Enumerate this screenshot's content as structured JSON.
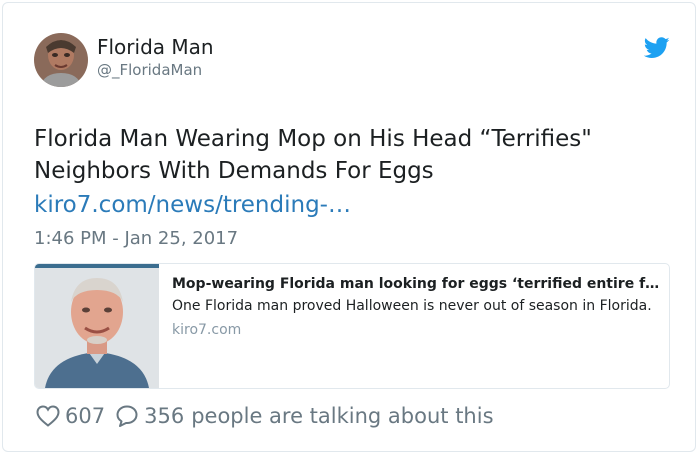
{
  "author": {
    "display_name": "Florida Man",
    "handle": "@_FloridaMan",
    "avatar_icon": "avatar-photo"
  },
  "tweet": {
    "text": "Florida Man Wearing Mop on His Head “Terrifies\" Neighbors With Demands For Eggs",
    "link_text": "kiro7.com/news/trending-…",
    "timestamp": "1:46 PM - Jan 25, 2017"
  },
  "link_card": {
    "title": "Mop-wearing Florida man looking for eggs ‘terrified entire f…",
    "description": "One Florida man proved Halloween is never out of season in Florida.",
    "domain": "kiro7.com",
    "image_icon": "mugshot-photo"
  },
  "actions": {
    "likes": "607",
    "replies": "356",
    "talking_text": "people are talking about this"
  },
  "colors": {
    "brand": "#1da1f2",
    "link": "#2b7bb9",
    "muted": "#697882",
    "text": "#1c2022",
    "border": "#e1e8ed"
  }
}
